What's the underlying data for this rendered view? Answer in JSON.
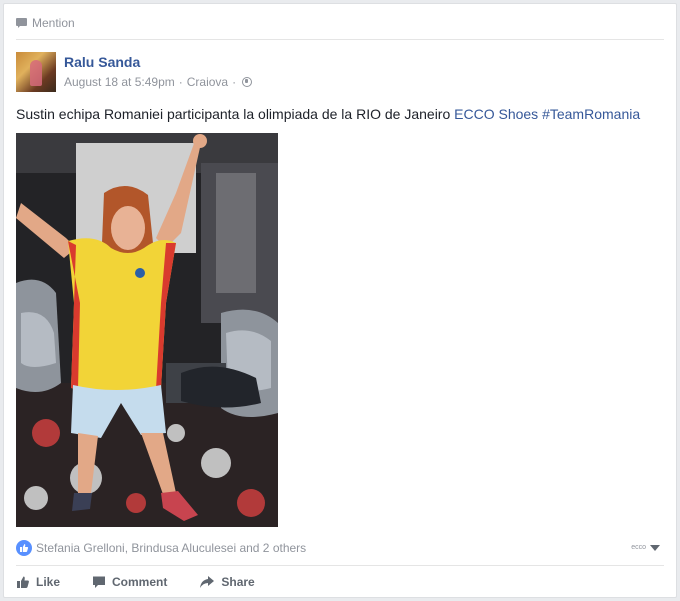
{
  "mention": {
    "icon": "speech-bubble-icon",
    "label": "Mention"
  },
  "post": {
    "author": "Ralu Sanda",
    "timestamp": "August 18 at 5:49pm",
    "separator": "·",
    "location": "Craiova",
    "privacy_icon": "globe-icon",
    "text_plain": "Sustin echipa Romaniei participanta la olimpiada de la RIO de Janeiro ",
    "text_link_page": "ECCO Shoes",
    "text_link_hashtag": "#TeamRomania"
  },
  "reactions": {
    "icon": "like-icon",
    "summary": "Stefania Grelloni, Brindusa Aluculesei and 2 others",
    "page_selector": "ecco"
  },
  "actions": {
    "like_label": "Like",
    "comment_label": "Comment",
    "share_label": "Share"
  },
  "colors": {
    "link": "#365899",
    "meta": "#90949c",
    "like_badge": "#5890ff"
  }
}
